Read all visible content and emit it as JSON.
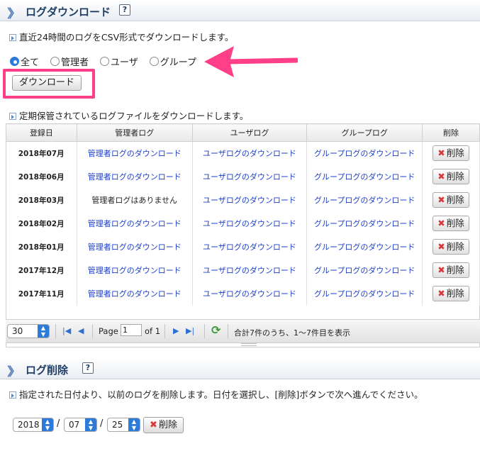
{
  "download_section": {
    "title": "ログダウンロード",
    "help": "?",
    "note1": "直近24時間のログをCSV形式でダウンロードします。",
    "radios": [
      "全て",
      "管理者",
      "ユーザ",
      "グループ"
    ],
    "selected_radio": 0,
    "download_button": "ダウンロード",
    "note2": "定期保管されているログファイルをダウンロードします。"
  },
  "table": {
    "headers": [
      "登録日",
      "管理者ログ",
      "ユーザログ",
      "グループログ",
      "削除"
    ],
    "delete_label": "削除",
    "rows": [
      {
        "date": "2018年07月",
        "admin": "管理者ログのダウンロード",
        "admin_link": true,
        "user": "ユーザログのダウンロード",
        "group": "グループログのダウンロード"
      },
      {
        "date": "2018年06月",
        "admin": "管理者ログのダウンロード",
        "admin_link": true,
        "user": "ユーザログのダウンロード",
        "group": "グループログのダウンロード"
      },
      {
        "date": "2018年03月",
        "admin": "管理者ログはありません",
        "admin_link": false,
        "user": "ユーザログのダウンロード",
        "group": "グループログのダウンロード"
      },
      {
        "date": "2018年02月",
        "admin": "管理者ログのダウンロード",
        "admin_link": true,
        "user": "ユーザログのダウンロード",
        "group": "グループログのダウンロード"
      },
      {
        "date": "2018年01月",
        "admin": "管理者ログのダウンロード",
        "admin_link": true,
        "user": "ユーザログのダウンロード",
        "group": "グループログのダウンロード"
      },
      {
        "date": "2017年12月",
        "admin": "管理者ログのダウンロード",
        "admin_link": true,
        "user": "ユーザログのダウンロード",
        "group": "グループログのダウンロード"
      },
      {
        "date": "2017年11月",
        "admin": "管理者ログのダウンロード",
        "admin_link": true,
        "user": "ユーザログのダウンロード",
        "group": "グループログのダウンロード"
      }
    ]
  },
  "pager": {
    "page_size": "30",
    "page_label": "Page",
    "page_value": "1",
    "of_label": "of 1",
    "summary": "合計7件のうち、1〜7件目を表示"
  },
  "delete_section": {
    "title": "ログ削除",
    "help": "?",
    "note": "指定された日付より、以前のログを削除します。日付を選択し、[削除]ボタンで次へ進んでください。",
    "year": "2018",
    "month": "07",
    "day": "25",
    "separator": "/",
    "delete_button": "削除"
  },
  "colors": {
    "highlight": "#ff3f87",
    "link": "#1a3dcc",
    "accent": "#2d7bd9"
  }
}
